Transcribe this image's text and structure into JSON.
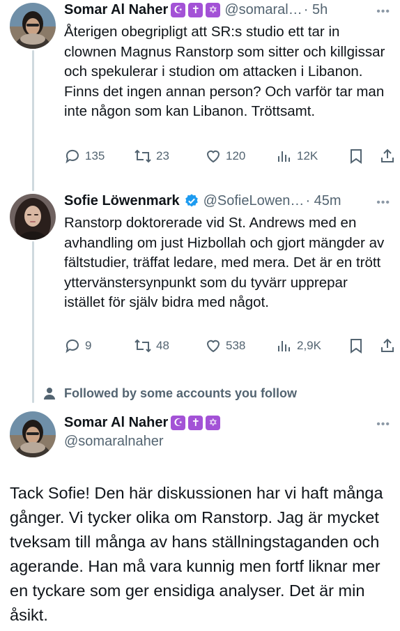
{
  "tweets": [
    {
      "name": "Somar Al Naher",
      "badges": [
        "☪",
        "✝",
        "✡"
      ],
      "handle": "@somaral…",
      "time": "· 5h",
      "text": "Återigen obegripligt att SR:s studio ett tar in clownen Magnus Ranstorp som sitter och killgissar och spekulerar i studion om attacken i Libanon. Finns det ingen annan person?  Och varför tar man inte någon som kan Libanon. Tröttsamt.",
      "stats": {
        "replies": "135",
        "reposts": "23",
        "likes": "120",
        "views": "12K"
      }
    },
    {
      "name": "Sofie Löwenmark",
      "verified": true,
      "handle": "@SofieLowen…",
      "time": "· 45m",
      "text": "Ranstorp doktorerade vid St. Andrews med en avhandling om just Hizbollah och gjort mängder av fältstudier, träffat ledare, med mera. Det är en trött ytterväns­tersynpunkt som du tyvärr upprepar istället för själv bidra med något.",
      "stats": {
        "replies": "9",
        "reposts": "48",
        "likes": "538",
        "views": "2,9K"
      }
    }
  ],
  "followed_notice": "Followed by some accounts you follow",
  "main_tweet": {
    "name": "Somar Al Naher",
    "badges": [
      "☪",
      "✝",
      "✡"
    ],
    "handle": "@somaralnaher",
    "text": "Tack Sofie! Den här diskussionen har vi haft många gånger. Vi tycker olika om Ranstorp. Jag är mycket tveksam till  många av hans ställningstaganden och agerande. Han må vara kunnig men fortf liknar mer en tyckare som ger ensidiga analyser. Det är min åsikt."
  },
  "more_label": "•••",
  "colors": {
    "text": "#0f1419",
    "secondary": "#536471",
    "badge": "#a352d6",
    "verified": "#1d9bf0",
    "thread": "#cfd9de"
  }
}
